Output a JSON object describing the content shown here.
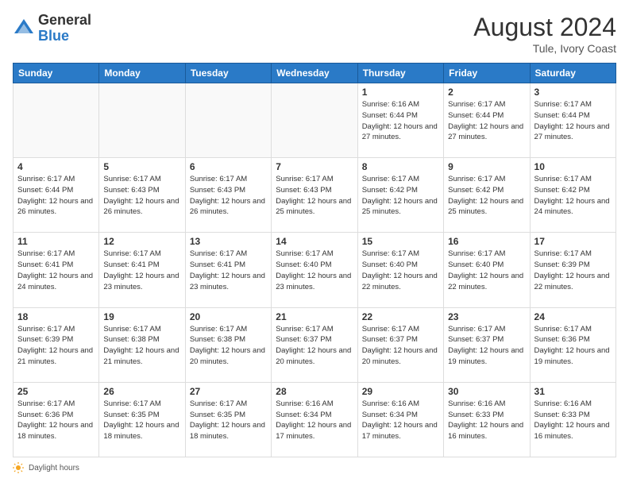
{
  "logo": {
    "general": "General",
    "blue": "Blue"
  },
  "title": {
    "month_year": "August 2024",
    "location": "Tule, Ivory Coast"
  },
  "days_of_week": [
    "Sunday",
    "Monday",
    "Tuesday",
    "Wednesday",
    "Thursday",
    "Friday",
    "Saturday"
  ],
  "footer": {
    "daylight_hours": "Daylight hours"
  },
  "weeks": [
    [
      {
        "day": "",
        "sunrise": "",
        "sunset": "",
        "daylight": "",
        "empty": true
      },
      {
        "day": "",
        "sunrise": "",
        "sunset": "",
        "daylight": "",
        "empty": true
      },
      {
        "day": "",
        "sunrise": "",
        "sunset": "",
        "daylight": "",
        "empty": true
      },
      {
        "day": "",
        "sunrise": "",
        "sunset": "",
        "daylight": "",
        "empty": true
      },
      {
        "day": "1",
        "sunrise": "Sunrise: 6:16 AM",
        "sunset": "Sunset: 6:44 PM",
        "daylight": "Daylight: 12 hours and 27 minutes.",
        "empty": false
      },
      {
        "day": "2",
        "sunrise": "Sunrise: 6:17 AM",
        "sunset": "Sunset: 6:44 PM",
        "daylight": "Daylight: 12 hours and 27 minutes.",
        "empty": false
      },
      {
        "day": "3",
        "sunrise": "Sunrise: 6:17 AM",
        "sunset": "Sunset: 6:44 PM",
        "daylight": "Daylight: 12 hours and 27 minutes.",
        "empty": false
      }
    ],
    [
      {
        "day": "4",
        "sunrise": "Sunrise: 6:17 AM",
        "sunset": "Sunset: 6:44 PM",
        "daylight": "Daylight: 12 hours and 26 minutes.",
        "empty": false
      },
      {
        "day": "5",
        "sunrise": "Sunrise: 6:17 AM",
        "sunset": "Sunset: 6:43 PM",
        "daylight": "Daylight: 12 hours and 26 minutes.",
        "empty": false
      },
      {
        "day": "6",
        "sunrise": "Sunrise: 6:17 AM",
        "sunset": "Sunset: 6:43 PM",
        "daylight": "Daylight: 12 hours and 26 minutes.",
        "empty": false
      },
      {
        "day": "7",
        "sunrise": "Sunrise: 6:17 AM",
        "sunset": "Sunset: 6:43 PM",
        "daylight": "Daylight: 12 hours and 25 minutes.",
        "empty": false
      },
      {
        "day": "8",
        "sunrise": "Sunrise: 6:17 AM",
        "sunset": "Sunset: 6:42 PM",
        "daylight": "Daylight: 12 hours and 25 minutes.",
        "empty": false
      },
      {
        "day": "9",
        "sunrise": "Sunrise: 6:17 AM",
        "sunset": "Sunset: 6:42 PM",
        "daylight": "Daylight: 12 hours and 25 minutes.",
        "empty": false
      },
      {
        "day": "10",
        "sunrise": "Sunrise: 6:17 AM",
        "sunset": "Sunset: 6:42 PM",
        "daylight": "Daylight: 12 hours and 24 minutes.",
        "empty": false
      }
    ],
    [
      {
        "day": "11",
        "sunrise": "Sunrise: 6:17 AM",
        "sunset": "Sunset: 6:41 PM",
        "daylight": "Daylight: 12 hours and 24 minutes.",
        "empty": false
      },
      {
        "day": "12",
        "sunrise": "Sunrise: 6:17 AM",
        "sunset": "Sunset: 6:41 PM",
        "daylight": "Daylight: 12 hours and 23 minutes.",
        "empty": false
      },
      {
        "day": "13",
        "sunrise": "Sunrise: 6:17 AM",
        "sunset": "Sunset: 6:41 PM",
        "daylight": "Daylight: 12 hours and 23 minutes.",
        "empty": false
      },
      {
        "day": "14",
        "sunrise": "Sunrise: 6:17 AM",
        "sunset": "Sunset: 6:40 PM",
        "daylight": "Daylight: 12 hours and 23 minutes.",
        "empty": false
      },
      {
        "day": "15",
        "sunrise": "Sunrise: 6:17 AM",
        "sunset": "Sunset: 6:40 PM",
        "daylight": "Daylight: 12 hours and 22 minutes.",
        "empty": false
      },
      {
        "day": "16",
        "sunrise": "Sunrise: 6:17 AM",
        "sunset": "Sunset: 6:40 PM",
        "daylight": "Daylight: 12 hours and 22 minutes.",
        "empty": false
      },
      {
        "day": "17",
        "sunrise": "Sunrise: 6:17 AM",
        "sunset": "Sunset: 6:39 PM",
        "daylight": "Daylight: 12 hours and 22 minutes.",
        "empty": false
      }
    ],
    [
      {
        "day": "18",
        "sunrise": "Sunrise: 6:17 AM",
        "sunset": "Sunset: 6:39 PM",
        "daylight": "Daylight: 12 hours and 21 minutes.",
        "empty": false
      },
      {
        "day": "19",
        "sunrise": "Sunrise: 6:17 AM",
        "sunset": "Sunset: 6:38 PM",
        "daylight": "Daylight: 12 hours and 21 minutes.",
        "empty": false
      },
      {
        "day": "20",
        "sunrise": "Sunrise: 6:17 AM",
        "sunset": "Sunset: 6:38 PM",
        "daylight": "Daylight: 12 hours and 20 minutes.",
        "empty": false
      },
      {
        "day": "21",
        "sunrise": "Sunrise: 6:17 AM",
        "sunset": "Sunset: 6:37 PM",
        "daylight": "Daylight: 12 hours and 20 minutes.",
        "empty": false
      },
      {
        "day": "22",
        "sunrise": "Sunrise: 6:17 AM",
        "sunset": "Sunset: 6:37 PM",
        "daylight": "Daylight: 12 hours and 20 minutes.",
        "empty": false
      },
      {
        "day": "23",
        "sunrise": "Sunrise: 6:17 AM",
        "sunset": "Sunset: 6:37 PM",
        "daylight": "Daylight: 12 hours and 19 minutes.",
        "empty": false
      },
      {
        "day": "24",
        "sunrise": "Sunrise: 6:17 AM",
        "sunset": "Sunset: 6:36 PM",
        "daylight": "Daylight: 12 hours and 19 minutes.",
        "empty": false
      }
    ],
    [
      {
        "day": "25",
        "sunrise": "Sunrise: 6:17 AM",
        "sunset": "Sunset: 6:36 PM",
        "daylight": "Daylight: 12 hours and 18 minutes.",
        "empty": false
      },
      {
        "day": "26",
        "sunrise": "Sunrise: 6:17 AM",
        "sunset": "Sunset: 6:35 PM",
        "daylight": "Daylight: 12 hours and 18 minutes.",
        "empty": false
      },
      {
        "day": "27",
        "sunrise": "Sunrise: 6:17 AM",
        "sunset": "Sunset: 6:35 PM",
        "daylight": "Daylight: 12 hours and 18 minutes.",
        "empty": false
      },
      {
        "day": "28",
        "sunrise": "Sunrise: 6:16 AM",
        "sunset": "Sunset: 6:34 PM",
        "daylight": "Daylight: 12 hours and 17 minutes.",
        "empty": false
      },
      {
        "day": "29",
        "sunrise": "Sunrise: 6:16 AM",
        "sunset": "Sunset: 6:34 PM",
        "daylight": "Daylight: 12 hours and 17 minutes.",
        "empty": false
      },
      {
        "day": "30",
        "sunrise": "Sunrise: 6:16 AM",
        "sunset": "Sunset: 6:33 PM",
        "daylight": "Daylight: 12 hours and 16 minutes.",
        "empty": false
      },
      {
        "day": "31",
        "sunrise": "Sunrise: 6:16 AM",
        "sunset": "Sunset: 6:33 PM",
        "daylight": "Daylight: 12 hours and 16 minutes.",
        "empty": false
      }
    ]
  ]
}
